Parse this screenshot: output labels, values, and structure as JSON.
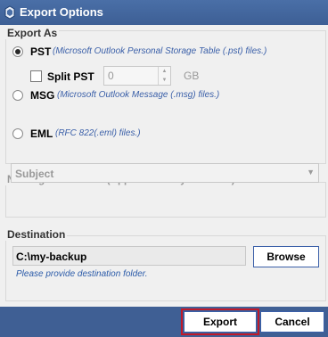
{
  "window": {
    "title": "Export Options"
  },
  "export_as": {
    "label": "Export As",
    "pst": {
      "label": "PST",
      "description": "(Microsoft Outlook Personal Storage Table (.pst) files.)",
      "checked": true
    },
    "split_pst": {
      "label": "Split PST",
      "checked": false,
      "value": "0",
      "unit": "GB"
    },
    "msg": {
      "label": "MSG",
      "description": "(Microsoft Outlook Message (.msg) files.)",
      "checked": false
    },
    "eml": {
      "label": "EML",
      "description": "(RFC 822(.eml) files.)",
      "checked": false
    }
  },
  "naming": {
    "label": "Naming Convention (Applicable only for mails)",
    "selected": "Subject"
  },
  "destination": {
    "label": "Destination",
    "path": "C:\\my-backup",
    "browse_label": "Browse",
    "hint": "Please provide destination folder."
  },
  "footer": {
    "export_label": "Export",
    "cancel_label": "Cancel"
  },
  "colors": {
    "titlebar": "#3d5f95",
    "footer": "#3f5f94",
    "focus": "#c0192a",
    "accent_text": "#3a5fa8"
  }
}
